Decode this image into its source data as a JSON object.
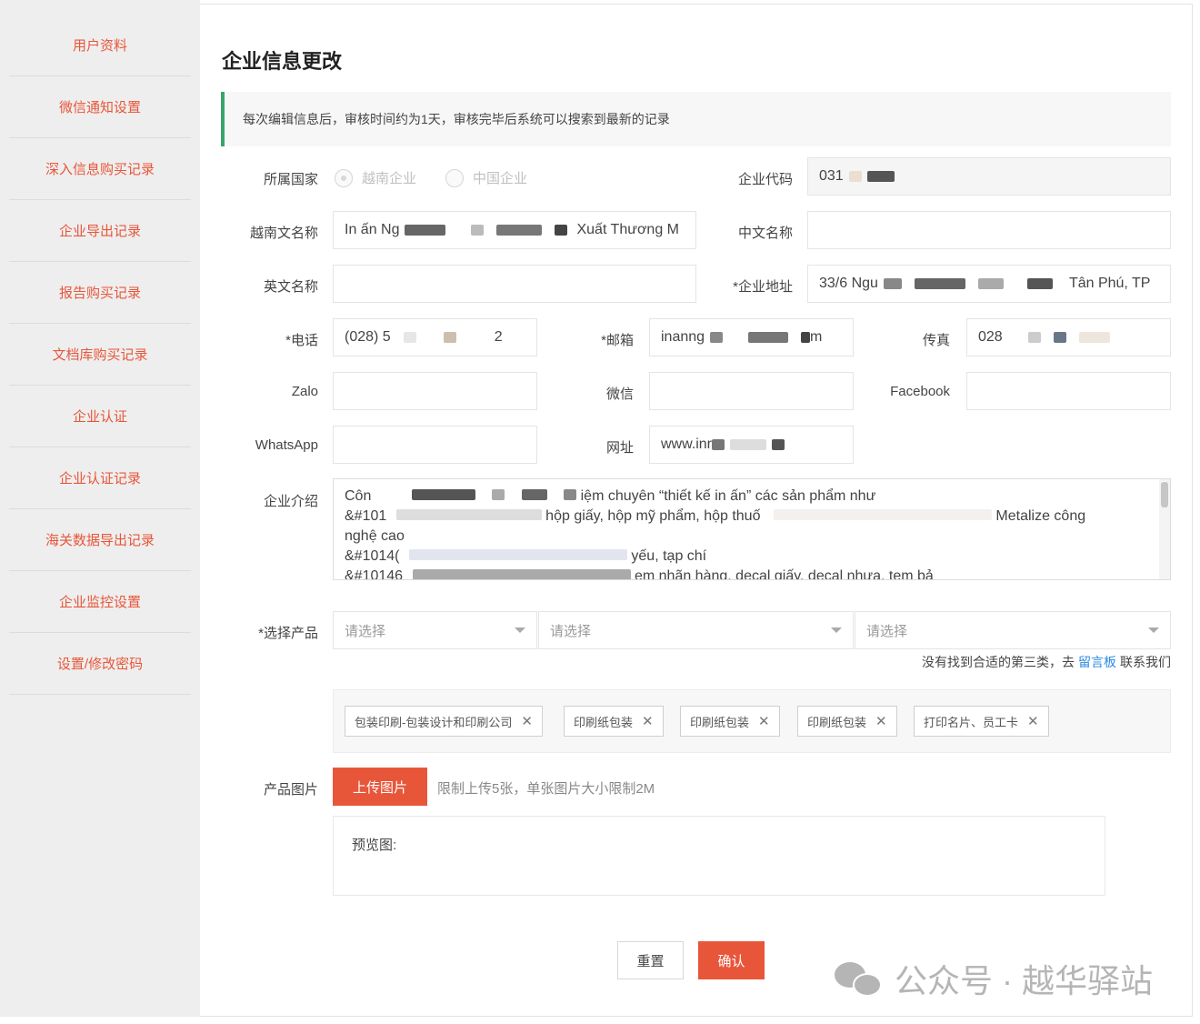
{
  "sidebar": {
    "items": [
      {
        "label": "用户资料"
      },
      {
        "label": "微信通知设置"
      },
      {
        "label": "深入信息购买记录"
      },
      {
        "label": "企业导出记录"
      },
      {
        "label": "报告购买记录"
      },
      {
        "label": "文档库购买记录"
      },
      {
        "label": "企业认证"
      },
      {
        "label": "企业认证记录"
      },
      {
        "label": "海关数据导出记录"
      },
      {
        "label": "企业监控设置"
      },
      {
        "label": "设置/修改密码"
      }
    ]
  },
  "page": {
    "title": "企业信息更改",
    "notice": "每次编辑信息后，审核时间约为1天，审核完毕后系统可以搜索到最新的记录"
  },
  "form": {
    "country_label": "所属国家",
    "country_options": [
      "越南企业",
      "中国企业"
    ],
    "code_label": "企业代码",
    "code_value": "031",
    "vn_name_label": "越南文名称",
    "vn_name_value_start": "In ấn Ng",
    "vn_name_value_end": "Xuất Thương M",
    "cn_name_label": "中文名称",
    "cn_name_value": "",
    "en_name_label": "英文名称",
    "en_name_value": "",
    "address_label": "*企业地址",
    "address_value_start": "33/6 Ngu",
    "address_value_end": "Tân Phú, TP",
    "phone_label": "*电话",
    "phone_value_start": "(028) 5",
    "phone_value_end": "2",
    "email_label": "*邮箱",
    "email_value_start": "inanng",
    "email_value_end": "m",
    "fax_label": "传真",
    "fax_value": "028",
    "zalo_label": "Zalo",
    "zalo_value": "",
    "wechat_label": "微信",
    "wechat_value": "",
    "facebook_label": "Facebook",
    "facebook_value": "",
    "whatsapp_label": "WhatsApp",
    "whatsapp_value": "",
    "website_label": "网址",
    "website_value": "www.inr",
    "intro_label": "企业介绍",
    "intro_lines": [
      "Côn",
      "iệm chuyên   “thiết kế in ấn”   các sản phẩm như",
      "&#101",
      "hộp giấy, hộp mỹ phẩm, hộp thuố",
      "Metalize công",
      "nghệ cao",
      "&#1014(",
      "yếu, tạp chí",
      "&#10146",
      "em nhãn hàng, decal giấy, decal nhựa, tem bả"
    ],
    "product_label": "*选择产品",
    "select_placeholder": "请选择",
    "hint_text": "没有找到合适的第三类，去",
    "hint_link": "留言板",
    "hint_tail": "联系我们",
    "tags": [
      "包装印刷-包装设计和印刷公司",
      "印刷纸包装",
      "印刷纸包装",
      "印刷纸包装",
      "打印名片、员工卡"
    ],
    "image_label": "产品图片",
    "upload_button": "上传图片",
    "upload_hint": "限制上传5张，单张图片大小限制2M",
    "preview_label": "预览图:",
    "reset_button": "重置",
    "confirm_button": "确认"
  },
  "watermark": {
    "text": "公众号 · 越华驿站"
  },
  "colors": {
    "accent": "#e8563a",
    "notice_border": "#3aa56a",
    "link": "#2b8ae2"
  }
}
